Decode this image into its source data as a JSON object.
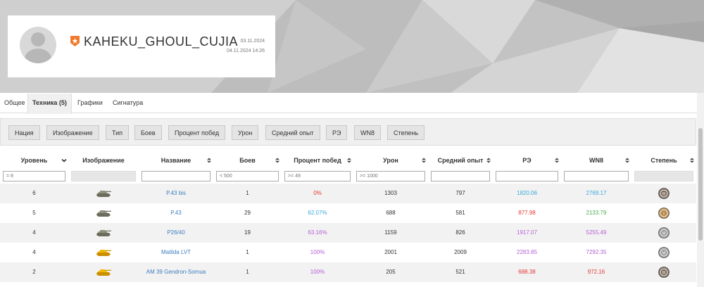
{
  "profile": {
    "nickname": "KAHEKU_GHOUL_CUJIA",
    "date_created": "03.11.2024",
    "date_updated": "04.11.2024 14:26",
    "rank_icon": "star-rank-icon"
  },
  "tabs": [
    {
      "label": "Общее",
      "active": false
    },
    {
      "label": "Техника (5)",
      "active": true
    },
    {
      "label": "Графики",
      "active": false
    },
    {
      "label": "Сигнатура",
      "active": false
    }
  ],
  "filters": [
    "Нация",
    "Изображение",
    "Тип",
    "Боев",
    "Процент побед",
    "Урон",
    "Средний опыт",
    "РЭ",
    "WN8",
    "Степень"
  ],
  "columns": [
    {
      "label": "Уровень",
      "sort": "down",
      "filter": "= 8"
    },
    {
      "label": "Изображение",
      "sort": "",
      "filter": null
    },
    {
      "label": "Название",
      "sort": "both",
      "filter": ""
    },
    {
      "label": "Боев",
      "sort": "both",
      "filter": "< 500"
    },
    {
      "label": "Процент побед",
      "sort": "both",
      "filter": ">= 49"
    },
    {
      "label": "Урон",
      "sort": "both",
      "filter": ">= 1000"
    },
    {
      "label": "Средний опыт",
      "sort": "both",
      "filter": ""
    },
    {
      "label": "РЭ",
      "sort": "both",
      "filter": ""
    },
    {
      "label": "WN8",
      "sort": "both",
      "filter": ""
    },
    {
      "label": "Степень",
      "sort": "both",
      "filter": null
    }
  ],
  "rows": [
    {
      "level": "6",
      "tank": "P.43 bis",
      "tank_color": "gray",
      "battles": "1",
      "winrate": "0%",
      "winrate_color": "#e53935",
      "damage": "1303",
      "avg_xp": "797",
      "re": "1820.06",
      "re_color": "#38a9d8",
      "wn8": "2769.17",
      "wn8_color": "#38a9d8",
      "mastery": "3"
    },
    {
      "level": "5",
      "tank": "P.43",
      "tank_color": "gray",
      "battles": "29",
      "winrate": "62.07%",
      "winrate_color": "#38a9d8",
      "damage": "688",
      "avg_xp": "581",
      "re": "877.98",
      "re_color": "#e53935",
      "wn8": "2133.79",
      "wn8_color": "#4caf50",
      "mastery": "1"
    },
    {
      "level": "4",
      "tank": "P26/40",
      "tank_color": "gray",
      "battles": "19",
      "winrate": "63.16%",
      "winrate_color": "#b45fd6",
      "damage": "1159",
      "avg_xp": "826",
      "re": "1917.07",
      "re_color": "#b45fd6",
      "wn8": "5255.49",
      "wn8_color": "#b45fd6",
      "mastery": "0"
    },
    {
      "level": "4",
      "tank": "Matilda LVT",
      "tank_color": "gold",
      "battles": "1",
      "winrate": "100%",
      "winrate_color": "#b45fd6",
      "damage": "2001",
      "avg_xp": "2009",
      "re": "2283.85",
      "re_color": "#b45fd6",
      "wn8": "7292.35",
      "wn8_color": "#b45fd6",
      "mastery": "0"
    },
    {
      "level": "2",
      "tank": "AM 39 Gendron-Somua",
      "tank_color": "gold",
      "battles": "1",
      "winrate": "100%",
      "winrate_color": "#b45fd6",
      "damage": "205",
      "avg_xp": "521",
      "re": "688.38",
      "re_color": "#e53935",
      "wn8": "972.16",
      "wn8_color": "#e53935",
      "mastery": "3"
    }
  ]
}
